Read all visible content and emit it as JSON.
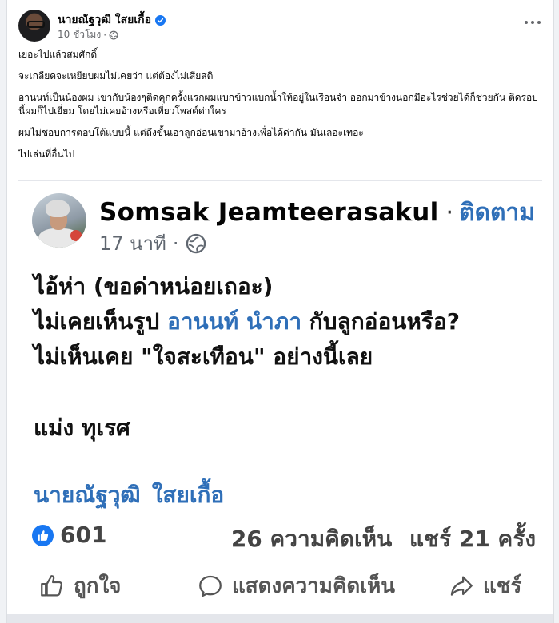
{
  "post": {
    "author": "นายณัฐวุฒิ ใสยเกื้อ",
    "time": "10 ชั่วโมง",
    "separator": "·",
    "paragraphs": [
      "เยอะไปแล้วสมศักดิ์",
      "จะเกลียดจะเหยียบผมไม่เคยว่า แต่ต้องไม่เสียสติ",
      "อานนท์เป็นน้องผม เขากับน้องๆติดคุกครั้งแรกผมแบกข้าวแบกน้ำให้อยู่ในเรือนจำ ออกมาข้างนอกมีอะไรช่วยได้ก็ช่วยกัน ติดรอบนี้ผมก็ไปเยี่ยม โดยไม่เคยอ้างหรือเที่ยวโพสต์ด่าใคร",
      "ผมไม่ชอบการตอบโต้แบบนี้ แต่ถึงขั้นเอาลูกอ่อนเขามาอ้างเพื่อได้ด่ากัน มันเลอะเทอะ",
      "ไปเล่นที่อื่นไป"
    ]
  },
  "shared": {
    "author": "Somsak Jeamteerasakul",
    "dot": "·",
    "follow": "ติดตาม",
    "time": "17 นาที",
    "time_dot": "·",
    "line1": "ไอ้ห่า (ขอด่าหน่อยเถอะ)",
    "line2_pre": "ไม่เคยเห็นรูป ",
    "line2_link": "อานนท์ นำภา",
    "line2_post": " กับลูกอ่อนหรือ?",
    "line3": "ไม่เห็นเคย \"ใจสะเทือน\" อย่างนี้เลย",
    "signoff": "แม่ง ทุเรศ",
    "tag_first": "นายณัฐวุฒิ",
    "tag_last": "ใสยเกื้อ",
    "likes": "601",
    "comments": "26 ความคิดเห็น",
    "shares": "แชร์ 21 ครั้ง",
    "actions": {
      "like": "ถูกใจ",
      "comment": "แสดงความคิดเห็น",
      "share": "แชร์"
    }
  },
  "colors": {
    "link": "#2f6fb8",
    "verified": "#1877f2",
    "meta": "#65676b"
  },
  "icons": [
    "verified-icon",
    "globe-icon",
    "more-icon",
    "like-icon",
    "comment-icon",
    "share-icon"
  ]
}
